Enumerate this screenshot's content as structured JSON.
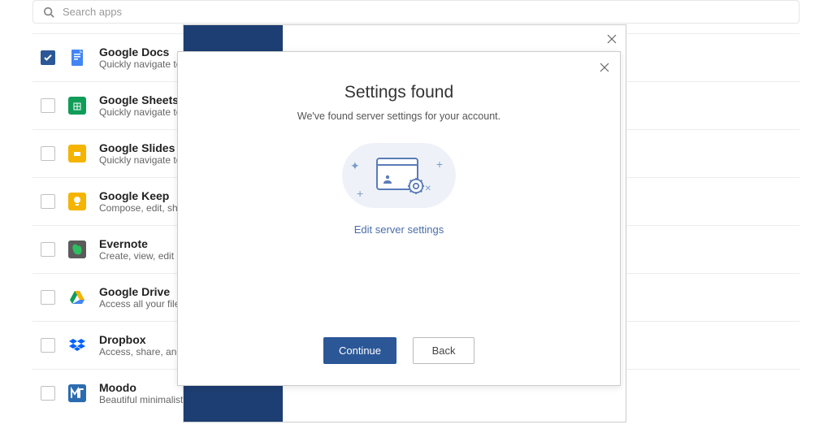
{
  "search": {
    "placeholder": "Search apps"
  },
  "apps": [
    {
      "name": "Google Docs",
      "desc": "Quickly navigate to your docs",
      "checked": true,
      "icon_bg": "#ffffff",
      "icon_svg": "docs"
    },
    {
      "name": "Google Sheets",
      "desc": "Quickly navigate to your sheets",
      "checked": false,
      "icon_bg": "#0f9d58",
      "icon_svg": "sheets"
    },
    {
      "name": "Google Slides",
      "desc": "Quickly navigate to your slides",
      "checked": false,
      "icon_bg": "#f4b400",
      "icon_svg": "slides"
    },
    {
      "name": "Google Keep",
      "desc": "Compose, edit, share",
      "checked": false,
      "icon_bg": "#f4b400",
      "icon_svg": "keep"
    },
    {
      "name": "Evernote",
      "desc": "Create, view, edit notes",
      "checked": false,
      "icon_bg": "#2dbe60",
      "icon_svg": "evernote"
    },
    {
      "name": "Google Drive",
      "desc": "Access all your files in",
      "checked": false,
      "icon_bg": "#ffffff",
      "icon_svg": "drive"
    },
    {
      "name": "Dropbox",
      "desc": "Access, share, and organize",
      "checked": false,
      "icon_bg": "#ffffff",
      "icon_svg": "dropbox"
    },
    {
      "name": "Moodo",
      "desc": "Beautiful minimalistic",
      "checked": false,
      "icon_bg": "#2b6cb0",
      "icon_svg": "moodo"
    }
  ],
  "modal": {
    "title": "Settings found",
    "subtitle": "We've found server settings for your account.",
    "edit_link": "Edit server settings",
    "continue_label": "Continue",
    "back_label": "Back"
  }
}
